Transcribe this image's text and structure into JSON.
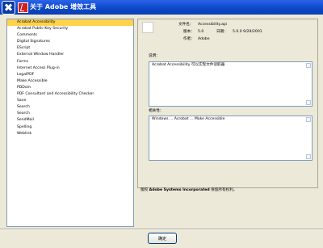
{
  "window": {
    "title": "关于 Adobe 增效工具"
  },
  "plugins": {
    "items": [
      "Acrobat Accessibility",
      "Acrobat Public-Key Security",
      "Comments",
      "Digital Signatures",
      "EScript",
      "External Window Handler",
      "Forms",
      "Internet Access Plug-in",
      "LegalPDF",
      "Make Accessible",
      "PDDom",
      "PDF Consultant and Accessibility Checker",
      "Save",
      "Search",
      "Search",
      "SendMail",
      "Spelling",
      "Weblink"
    ],
    "selected_index": 0
  },
  "details": {
    "file_name_label": "文件名：",
    "file_name": "Accessibility.api",
    "version_label": "版本：",
    "version": "5.0",
    "date_label": "日期：",
    "date": "5.0.0 9/29/2001",
    "author_label": "作者：",
    "author": "Adobe",
    "description_label": "说明：",
    "description": "Acrobat Accessibility 可以实现文件读取器",
    "dependencies_label": "相关性：",
    "dependencies": "Windows ...  Acrobat ...  Make Accessible"
  },
  "footer": {
    "prefix": "版权",
    "company": "Adobe Systems Incorporated",
    "suffix": "保留所有权利。"
  },
  "buttons": {
    "close": "确定"
  }
}
